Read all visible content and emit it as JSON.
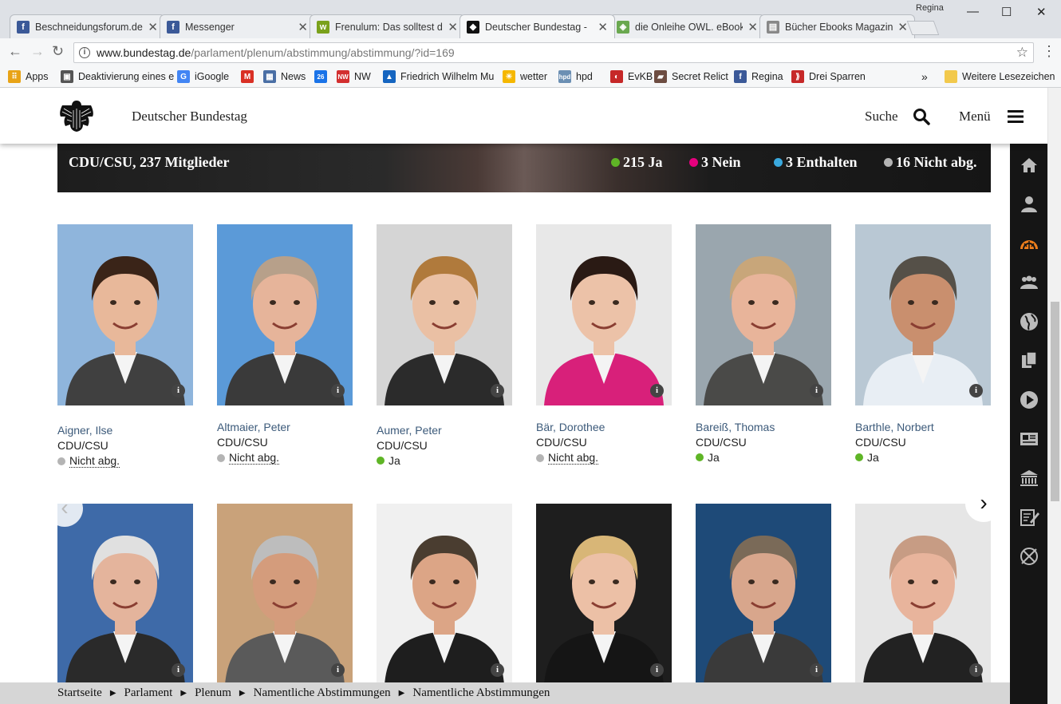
{
  "browser": {
    "profile_name": "Regina",
    "tabs": [
      {
        "title": "Beschneidungsforum.de",
        "icon": "facebook-icon",
        "color": "#3b5998",
        "glyph": "f"
      },
      {
        "title": "Messenger",
        "icon": "facebook-icon",
        "color": "#3b5998",
        "glyph": "f"
      },
      {
        "title": "Frenulum: Das solltest du",
        "icon": "frenulum-icon",
        "color": "#7aa11b",
        "glyph": "w"
      },
      {
        "title": "Deutscher Bundestag - ",
        "icon": "bundestag-eagle-icon",
        "color": "#111111",
        "glyph": "◆"
      },
      {
        "title": "die Onleihe OWL. eBook",
        "icon": "onleihe-icon",
        "color": "#6aa84f",
        "glyph": "◈"
      },
      {
        "title": "Bücher Ebooks Magazin",
        "icon": "document-icon",
        "color": "#888888",
        "glyph": "▤"
      }
    ],
    "url_host": "www.bundestag.de",
    "url_path": "/parlament/plenum/abstimmung/abstimmung/?id=169",
    "bookmarks": [
      {
        "label": "Apps",
        "icon": "apps-grid-icon",
        "color": "#e8a317",
        "glyph": "⠿"
      },
      {
        "label": "Deaktivierung eines e",
        "icon": "page-icon",
        "color": "#555555",
        "glyph": "▣"
      },
      {
        "label": "iGoogle",
        "icon": "google-icon",
        "color": "#4285f4",
        "glyph": "G"
      },
      {
        "label": "",
        "icon": "gmail-icon",
        "color": "#d93025",
        "glyph": "M"
      },
      {
        "label": "News",
        "icon": "news-icon",
        "color": "#4a6fa5",
        "glyph": "▦"
      },
      {
        "label": "",
        "icon": "calendar-icon",
        "color": "#1a73e8",
        "glyph": "26"
      },
      {
        "label": "NW",
        "icon": "nw-icon",
        "color": "#d32f2f",
        "glyph": "NW"
      },
      {
        "label": "Friedrich Wilhelm Mu",
        "icon": "museum-icon",
        "color": "#1565c0",
        "glyph": "▲"
      },
      {
        "label": "wetter",
        "icon": "weather-icon",
        "color": "#f5b700",
        "glyph": "☀"
      },
      {
        "label": "hpd",
        "icon": "hpd-icon",
        "color": "#6b8fb3",
        "glyph": "hpd"
      },
      {
        "label": "EvKB",
        "icon": "evkb-icon",
        "color": "#c62828",
        "glyph": "◐"
      },
      {
        "label": "Secret Relict",
        "icon": "relict-icon",
        "color": "#6d4c41",
        "glyph": "▰"
      },
      {
        "label": "Regina",
        "icon": "facebook-icon",
        "color": "#3b5998",
        "glyph": "f"
      },
      {
        "label": "Drei Sparren",
        "icon": "sparren-icon",
        "color": "#c62828",
        "glyph": "⟫"
      }
    ],
    "more_bookmarks": "»",
    "other_bookmarks": "Weitere Lesezeichen"
  },
  "site": {
    "name": "Deutscher Bundestag",
    "search_label": "Suche",
    "menu_label": "Menü"
  },
  "faction": {
    "title": "CDU/CSU, 237 Mitglieder",
    "stats": [
      {
        "label": "215 Ja",
        "color": "#5fb526"
      },
      {
        "label": "3 Nein",
        "color": "#e6007e"
      },
      {
        "label": "3 Enthalten",
        "color": "#3aa9de"
      },
      {
        "label": "16 Nicht abg.",
        "color": "#b4b4b4"
      }
    ]
  },
  "members_row1": [
    {
      "name": "Aigner, Ilse",
      "party": "CDU/CSU",
      "vote": "Nicht abg.",
      "vote_color": "#b4b4b4",
      "bg": "#8fb5dc",
      "skin": "#e8b89a",
      "hair": "#3a2418",
      "suit": "#404040"
    },
    {
      "name": "Altmaier, Peter",
      "party": "CDU/CSU",
      "vote": "Nicht abg.",
      "vote_color": "#b4b4b4",
      "bg": "#5b9ad8",
      "skin": "#e6b49a",
      "hair": "#b7a08a",
      "suit": "#3a3a3a"
    },
    {
      "name": "Aumer, Peter",
      "party": "CDU/CSU",
      "vote": "Ja",
      "vote_color": "#5fb526",
      "bg": "#d5d5d5",
      "skin": "#eac0a4",
      "hair": "#b07a3c",
      "suit": "#2b2b2b"
    },
    {
      "name": "Bär, Dorothee",
      "party": "CDU/CSU",
      "vote": "Nicht abg.",
      "vote_color": "#b4b4b4",
      "bg": "#e8e8e8",
      "skin": "#ecc2a8",
      "hair": "#2a1a14",
      "suit": "#d8207a"
    },
    {
      "name": "Bareiß, Thomas",
      "party": "CDU/CSU",
      "vote": "Ja",
      "vote_color": "#5fb526",
      "bg": "#9aa6ae",
      "skin": "#e8b49a",
      "hair": "#c8a67a",
      "suit": "#4a4a48"
    },
    {
      "name": "Barthle, Norbert",
      "party": "CDU/CSU",
      "vote": "Ja",
      "vote_color": "#5fb526",
      "bg": "#b9c8d4",
      "skin": "#c98f6e",
      "hair": "#555048",
      "suit": "#e8eef4"
    }
  ],
  "members_row2": [
    {
      "bg": "#3e6aa8",
      "skin": "#e4b49c",
      "hair": "#e0e0e0",
      "suit": "#2a2a2a"
    },
    {
      "bg": "#c9a27a",
      "skin": "#d49c7c",
      "hair": "#bdbdbd",
      "suit": "#5a5a5a"
    },
    {
      "bg": "#f0f0f0",
      "skin": "#dca586",
      "hair": "#4a3d30",
      "suit": "#1e1e1e"
    },
    {
      "bg": "#1e1e1e",
      "skin": "#ecc0a6",
      "hair": "#d8b677",
      "suit": "#151515"
    },
    {
      "bg": "#1e4a78",
      "skin": "#d8a68c",
      "hair": "#7a6a58",
      "suit": "#3a3a3a"
    },
    {
      "bg": "#e6e6e6",
      "skin": "#e8b49c",
      "hair": "#c79c84",
      "suit": "#222222"
    }
  ],
  "sidebar_icons": [
    "home-icon",
    "person-icon",
    "plenum-icon",
    "group-icon",
    "globe-icon",
    "documents-icon",
    "play-icon",
    "news-icon",
    "building-icon",
    "edit-icon",
    "cancel-icon"
  ],
  "breadcrumb": [
    "Startseite",
    "Parlament",
    "Plenum",
    "Namentliche Abstimmungen",
    "Namentliche Abstimmungen"
  ],
  "info_glyph": "i"
}
